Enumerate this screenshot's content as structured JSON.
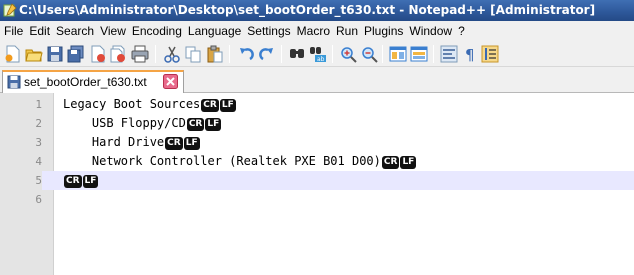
{
  "window": {
    "title": "C:\\Users\\Administrator\\Desktop\\set_bootOrder_t630.txt - Notepad++ [Administrator]"
  },
  "menu": {
    "items": [
      "File",
      "Edit",
      "Search",
      "View",
      "Encoding",
      "Language",
      "Settings",
      "Macro",
      "Run",
      "Plugins",
      "Window",
      "?"
    ]
  },
  "toolbar": {
    "buttons": [
      "new-file-icon",
      "open-file-icon",
      "save-icon",
      "save-all-icon",
      "close-icon",
      "close-all-icon",
      "print-icon",
      "cut-icon",
      "copy-icon",
      "paste-icon",
      "undo-icon",
      "redo-icon",
      "find-icon",
      "replace-icon",
      "zoom-in-icon",
      "zoom-out-icon",
      "sync-vertical-icon",
      "sync-horizontal-icon",
      "word-wrap-icon",
      "show-all-characters-icon",
      "indent-guide-icon"
    ]
  },
  "tab": {
    "label": "set_bootOrder_t630.txt"
  },
  "editor": {
    "current_line": 5,
    "eol_cr": "CR",
    "eol_lf": "LF",
    "lines": [
      {
        "num": "1",
        "text": "Legacy Boot Sources"
      },
      {
        "num": "2",
        "text": "    USB Floppy/CD"
      },
      {
        "num": "3",
        "text": "    Hard Drive"
      },
      {
        "num": "4",
        "text": "    Network Controller (Realtek PXE B01 D00)"
      },
      {
        "num": "5",
        "text": ""
      },
      {
        "num": "6",
        "text": ""
      }
    ]
  },
  "colors": {
    "titlebar": "#2d5799",
    "current_line": "#e8e8ff",
    "gutter": "#e4e4e4",
    "tab_accent": "#f5a445"
  }
}
